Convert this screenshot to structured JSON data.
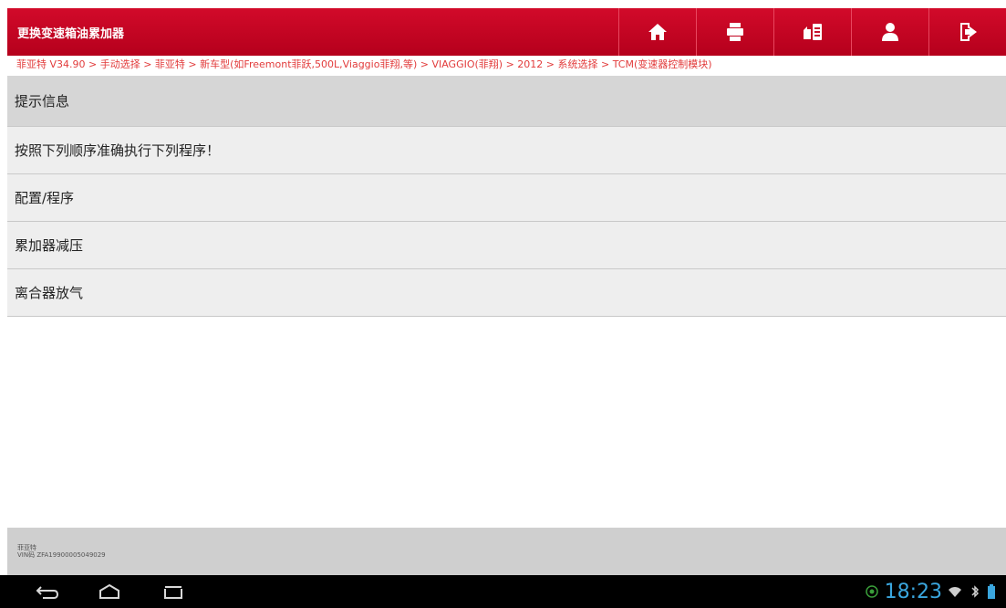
{
  "header": {
    "title": "更换变速箱油累加器",
    "tools": [
      {
        "name": "home",
        "icon": "home-icon"
      },
      {
        "name": "print",
        "icon": "print-icon"
      },
      {
        "name": "report",
        "icon": "report-icon"
      },
      {
        "name": "user",
        "icon": "user-icon"
      },
      {
        "name": "exit",
        "icon": "exit-icon"
      }
    ]
  },
  "breadcrumb": "菲亚特 V34.90 > 手动选择 > 菲亚特 > 新车型(如Freemont菲跃,500L,Viaggio菲翔,等) > VIAGGIO(菲翔) > 2012 > 系统选择 > TCM(变速器控制模块)",
  "list": {
    "header": "提示信息",
    "items": [
      "按照下列顺序准确执行下列程序！",
      "配置/程序",
      "累加器减压",
      "离合器放气"
    ]
  },
  "footer": {
    "make": "菲亚特",
    "vin": "VIN码 ZFA19900005049029"
  },
  "statusbar": {
    "time": "18:23"
  },
  "colors": {
    "header_red": "#c8102e",
    "breadcrumb_text": "#e23b3b",
    "clock_blue": "#3aa6de"
  }
}
